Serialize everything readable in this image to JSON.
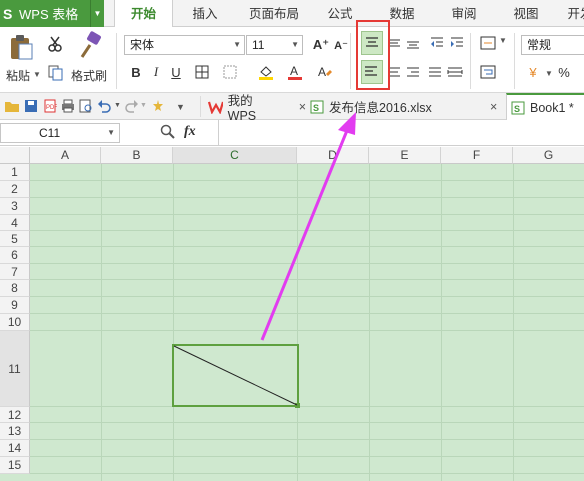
{
  "app": {
    "logo": "S",
    "title": "WPS 表格",
    "menu_arrow": "▼"
  },
  "menu_tabs": [
    {
      "label": "开始",
      "active": true
    },
    {
      "label": "插入"
    },
    {
      "label": "页面布局"
    },
    {
      "label": "公式"
    },
    {
      "label": "数据"
    },
    {
      "label": "审阅"
    },
    {
      "label": "视图"
    },
    {
      "label": "开发"
    }
  ],
  "ribbon": {
    "paste_label": "粘贴",
    "format_painter_label": "格式刷",
    "font_name": "宋体",
    "font_size": "11",
    "bold": "B",
    "italic": "I",
    "underline": "U",
    "grow_font": "A⁺",
    "shrink_font": "A⁻",
    "number_format": "常规",
    "percent": "%",
    "currency": "¥"
  },
  "doc_tabs": [
    {
      "label": "我的WPS",
      "icon": "wps-logo-icon",
      "close": "×"
    },
    {
      "label": "发布信息2016.xlsx",
      "icon": "excel-file-icon",
      "close": "×"
    },
    {
      "label": "Book1 *",
      "icon": "excel-file-icon",
      "active": true
    }
  ],
  "formula_bar": {
    "name_box": "C11",
    "fx": "fx",
    "formula": ""
  },
  "columns": [
    "A",
    "B",
    "C",
    "D",
    "E",
    "F",
    "G"
  ],
  "rows": [
    "1",
    "2",
    "3",
    "4",
    "5",
    "6",
    "7",
    "8",
    "9",
    "10",
    "11",
    "12",
    "13",
    "14",
    "15"
  ],
  "selected_cell": {
    "column": "C",
    "row": "11"
  },
  "colors": {
    "accent": "#4a9a3e",
    "cell_fill": "#cfe8cf",
    "highlight_box": "#e53935",
    "arrow": "#e23cf0",
    "selection_border": "#5ea03f"
  }
}
